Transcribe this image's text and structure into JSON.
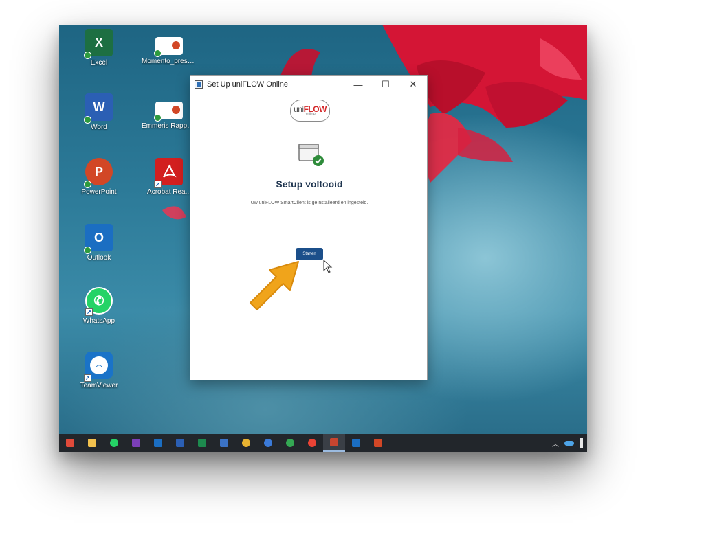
{
  "desktop": {
    "icons": [
      {
        "label": "Excel",
        "icon": "excel-icon",
        "color": "#1d6f42",
        "glyph": "X"
      },
      {
        "label": "Momento_present...",
        "icon": "powerpoint-file-icon",
        "color": "#ffffff",
        "glyph": ""
      },
      {
        "label": "Word",
        "icon": "word-icon",
        "color": "#2b5fb4",
        "glyph": "W"
      },
      {
        "label": "Emmeris Rappo...",
        "icon": "powerpoint-file-icon",
        "color": "#ffffff",
        "glyph": ""
      },
      {
        "label": "PowerPoint",
        "icon": "powerpoint-icon",
        "color": "#d24726",
        "glyph": "P"
      },
      {
        "label": "Acrobat Rea...",
        "icon": "acrobat-reader-icon",
        "color": "#d21f1f",
        "glyph": "A"
      },
      {
        "label": "Outlook",
        "icon": "outlook-icon",
        "color": "#1b6ec2",
        "glyph": "O"
      },
      {
        "label": "WhatsApp",
        "icon": "whatsapp-icon",
        "color": "#25d366",
        "glyph": "✆"
      },
      {
        "label": "TeamViewer",
        "icon": "teamviewer-icon",
        "color": "#1a73c8",
        "glyph": "⇔"
      }
    ]
  },
  "window": {
    "title": "Set Up uniFLOW Online",
    "minimize_glyph": "—",
    "maximize_glyph": "☐",
    "close_glyph": "✕",
    "logo_uni": "uni",
    "logo_flow": "FLOW",
    "logo_sub": "online",
    "heading": "Setup voltooid",
    "description": "Uw uniFLOW SmartClient is geïnstalleerd en ingesteld.",
    "start_button": "Starten"
  },
  "taskbar": {
    "items": [
      {
        "name": "taskbar-app-1",
        "icon": "start-app-icon",
        "color": "#e04a3a"
      },
      {
        "name": "taskbar-explorer",
        "icon": "folder-icon",
        "color": "#f2c14e"
      },
      {
        "name": "taskbar-whatsapp",
        "icon": "whatsapp-icon",
        "color": "#25d366"
      },
      {
        "name": "taskbar-onenote",
        "icon": "onenote-icon",
        "color": "#7b3fb8"
      },
      {
        "name": "taskbar-outlook",
        "icon": "outlook-icon",
        "color": "#1b6ec2"
      },
      {
        "name": "taskbar-word",
        "icon": "word-icon",
        "color": "#2b5fb4"
      },
      {
        "name": "taskbar-excel",
        "icon": "excel-icon",
        "color": "#1d8a4e"
      },
      {
        "name": "taskbar-teams",
        "icon": "teams-icon",
        "color": "#3b73c6"
      },
      {
        "name": "taskbar-chrome-1",
        "icon": "chrome-icon",
        "color": "#e8b331"
      },
      {
        "name": "taskbar-chrome-2",
        "icon": "chrome-icon",
        "color": "#3b7ad8"
      },
      {
        "name": "taskbar-chrome-3",
        "icon": "chrome-icon",
        "color": "#34a853"
      },
      {
        "name": "taskbar-chrome-4",
        "icon": "chrome-icon",
        "color": "#ea4335"
      },
      {
        "name": "taskbar-uniflow",
        "icon": "uniflow-icon",
        "color": "#c8452f",
        "active": true
      },
      {
        "name": "taskbar-outlook-2",
        "icon": "outlook-icon",
        "color": "#1b6ec2"
      },
      {
        "name": "taskbar-powerpoint",
        "icon": "powerpoint-icon",
        "color": "#d24726"
      }
    ]
  }
}
